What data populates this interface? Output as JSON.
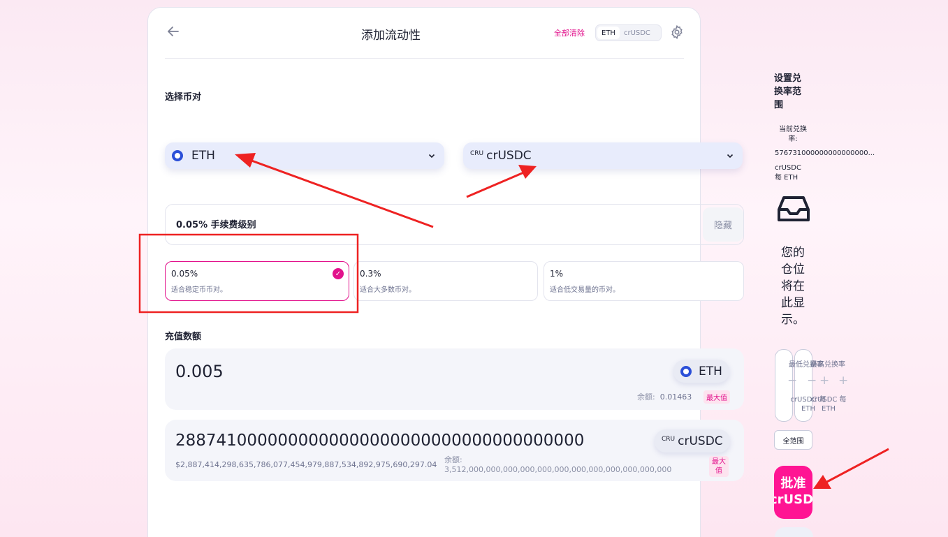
{
  "header": {
    "title": "添加流动性",
    "clear_all": "全部清除",
    "toggle": [
      "ETH",
      "crUSDC"
    ]
  },
  "pair": {
    "label": "选择币对",
    "token_a": "ETH",
    "token_b_prefix": "CRU",
    "token_b": "crUSDC"
  },
  "fee": {
    "title": "0.05% 手续费级别",
    "hide": "隐藏",
    "tiers": [
      {
        "value": "0.05%",
        "desc": "适合稳定币币对。"
      },
      {
        "value": "0.3%",
        "desc": "适合大多数币对。"
      },
      {
        "value": "1%",
        "desc": "适合低交易量的币对。"
      }
    ],
    "selected_index": 0
  },
  "deposit": {
    "label": "充值数额",
    "a": {
      "amount": "0.005",
      "token": "ETH",
      "balance_label": "余额:",
      "balance": "0.01463",
      "max": "最大值"
    },
    "b": {
      "amount": "2887410000000000000000000000000000000000",
      "usd": "$2,887,414,298,635,786,077,454,979,887,534,892,975,690,297.04",
      "token_prefix": "CRU",
      "token": "crUSDC",
      "balance_label": "余额:",
      "balance": "3,512,000,000,000,000,000,000,000,000,000,000,000,000",
      "max_line1": "最大",
      "max_line2": "值"
    }
  },
  "range": {
    "title_lines": [
      "设置兑",
      "换率范",
      "围"
    ],
    "current_label_1": "当前兑换",
    "current_label_2": "率:",
    "current_value": "576731000000000000000...",
    "unit_1": "crUSDC",
    "unit_2": "每 ETH",
    "empty_lines": [
      "您的",
      "仓位",
      "将在",
      "此显",
      "示。"
    ],
    "min_label": "最低兑换率",
    "max_label": "最高兑换率",
    "minus": "−",
    "plus": "+",
    "card_unit_a": "crUSDC 每",
    "card_unit_b": "ETH",
    "full_range": "全范围",
    "approve_line1": "批准",
    "approve_line2": "crUSDC"
  },
  "colors": {
    "accent": "#e2128c",
    "approve": "#ff1493",
    "select_bg": "#e8ecfc",
    "annotation": "#ee2222"
  }
}
